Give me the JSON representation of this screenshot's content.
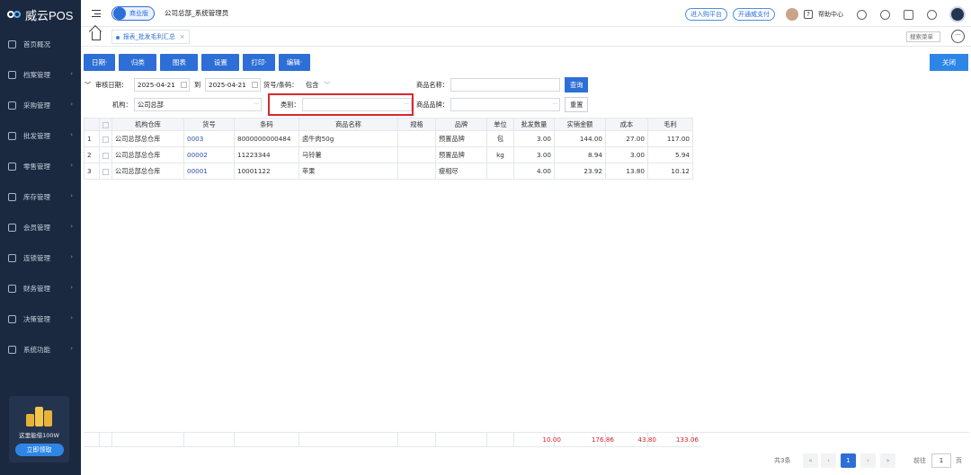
{
  "app": {
    "logo_text": "威云POS"
  },
  "sidebar": {
    "items": [
      {
        "label": "首页概况",
        "icon": "home-icon"
      },
      {
        "label": "档案管理",
        "icon": "folder-icon"
      },
      {
        "label": "采购管理",
        "icon": "cart-icon"
      },
      {
        "label": "批发管理",
        "icon": "building-icon"
      },
      {
        "label": "零售管理",
        "icon": "store-icon"
      },
      {
        "label": "库存管理",
        "icon": "inventory-icon"
      },
      {
        "label": "会员管理",
        "icon": "member-icon"
      },
      {
        "label": "连锁管理",
        "icon": "chain-icon"
      },
      {
        "label": "财务管理",
        "icon": "finance-icon"
      },
      {
        "label": "决策管理",
        "icon": "chart-icon"
      },
      {
        "label": "系统功能",
        "icon": "gear-icon"
      }
    ],
    "promo": {
      "title": "这里能借100W",
      "button": "立即领取"
    }
  },
  "header": {
    "edition": "商业版",
    "org": "公司总部_系统管理员",
    "purchase": "进入购平台",
    "pay": "开通威支付",
    "help": "帮助中心",
    "help_mark": "?"
  },
  "tabs": {
    "active": "报表_批发毛利汇总",
    "close": "×",
    "menu_search": "搜索菜单",
    "more": "···"
  },
  "toolbar": {
    "buttons": [
      "日期·",
      "归类",
      "图表",
      "设置",
      "打印·",
      "编辑·"
    ],
    "close": "关闭"
  },
  "filters": {
    "audit_date_label": "审核日期：",
    "date_from": "2025-04-21",
    "to_label": "到",
    "date_to": "2025-04-21",
    "code_label": "货号/条码：",
    "code_mode": "包含",
    "product_name_label": "商品名称：",
    "product_name": "",
    "query": "查询",
    "org_label": "机构：",
    "org_value": "公司总部",
    "category_label": "类别：",
    "category_value": "",
    "brand_label": "商品品牌：",
    "brand_value": "",
    "reset": "重置",
    "dots": "···"
  },
  "table": {
    "headers": [
      "机构仓库",
      "货号",
      "条码",
      "商品名称",
      "规格",
      "品牌",
      "单位",
      "批发数量",
      "实销金额",
      "成本",
      "毛利"
    ],
    "rows": [
      {
        "idx": "1",
        "warehouse": "公司总部总仓库",
        "code": "0003",
        "barcode": "8000000000484",
        "name": "卤牛肉50g",
        "spec": "",
        "brand": "预置品牌",
        "unit": "包",
        "qty": "3.00",
        "amount": "144.00",
        "cost": "27.00",
        "profit": "117.00"
      },
      {
        "idx": "2",
        "warehouse": "公司总部总仓库",
        "code": "00002",
        "barcode": "11223344",
        "name": "马铃薯",
        "spec": "",
        "brand": "预置品牌",
        "unit": "kg",
        "qty": "3.00",
        "amount": "8.94",
        "cost": "3.00",
        "profit": "5.94"
      },
      {
        "idx": "3",
        "warehouse": "公司总部总仓库",
        "code": "00001",
        "barcode": "10001122",
        "name": "苹果",
        "spec": "",
        "brand": "瘦相尽",
        "unit": "",
        "qty": "4.00",
        "amount": "23.92",
        "cost": "13.80",
        "profit": "10.12"
      }
    ],
    "totals": {
      "qty": "10.00",
      "amount": "176.86",
      "cost": "43.80",
      "profit": "133.06"
    }
  },
  "pager": {
    "total": "共3条",
    "prev": "‹",
    "first": "«",
    "page": "1",
    "next": "›",
    "last": "»",
    "goto_label": "前往",
    "goto_value": "1",
    "page_unit": "页"
  },
  "colors": {
    "primary": "#2d6fd6",
    "sidebar": "#1b2940",
    "highlight_box": "#d9282f",
    "totals": "#d4252c"
  }
}
